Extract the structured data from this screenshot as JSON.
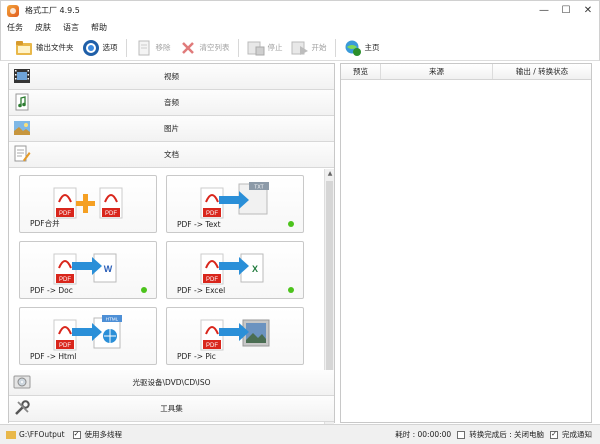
{
  "app": {
    "title": "格式工厂 4.9.5"
  },
  "window_controls": {
    "minimize": "—",
    "maximize": "☐",
    "close": "✕"
  },
  "menu": [
    "任务",
    "皮肤",
    "语言",
    "帮助"
  ],
  "toolbar": {
    "output_folder": "输出文件夹",
    "options": "选项",
    "remove": "移除",
    "clear_list": "清空列表",
    "stop": "停止",
    "start": "开始",
    "home": "主页"
  },
  "categories": {
    "video": "视频",
    "audio": "音频",
    "image": "图片",
    "document": "文档",
    "optical": "光驱设备\\DVD\\CD\\ISO",
    "tools": "工具集"
  },
  "tiles": [
    {
      "label": "PDF合并",
      "target": "PDF",
      "dot": false
    },
    {
      "label": "PDF -> Text",
      "target": "TXT",
      "dot": true
    },
    {
      "label": "PDF -> Doc",
      "target": "W",
      "dot": true
    },
    {
      "label": "PDF -> Excel",
      "target": "X",
      "dot": true
    },
    {
      "label": "PDF -> Html",
      "target": "HTML",
      "dot": false
    },
    {
      "label": "PDF -> Pic",
      "target": "PIC",
      "dot": false
    }
  ],
  "tile_icon_text": "PDF",
  "right_panel": {
    "columns": [
      "预览",
      "来源",
      "输出 / 转换状态"
    ]
  },
  "status": {
    "output_path": "G:\\FFOutput",
    "multithread_label": "使用多线程",
    "elapsed": "耗时 : 00:00:00",
    "after_convert": "转换完成后 : 关闭电脑",
    "notify": "完成通知",
    "check_mark": "✓"
  },
  "colors": {
    "accent_green": "#4cc31c",
    "pdf_red": "#d9261c",
    "arrow_blue": "#2a8fd8",
    "plus_orange": "#f5a023"
  }
}
